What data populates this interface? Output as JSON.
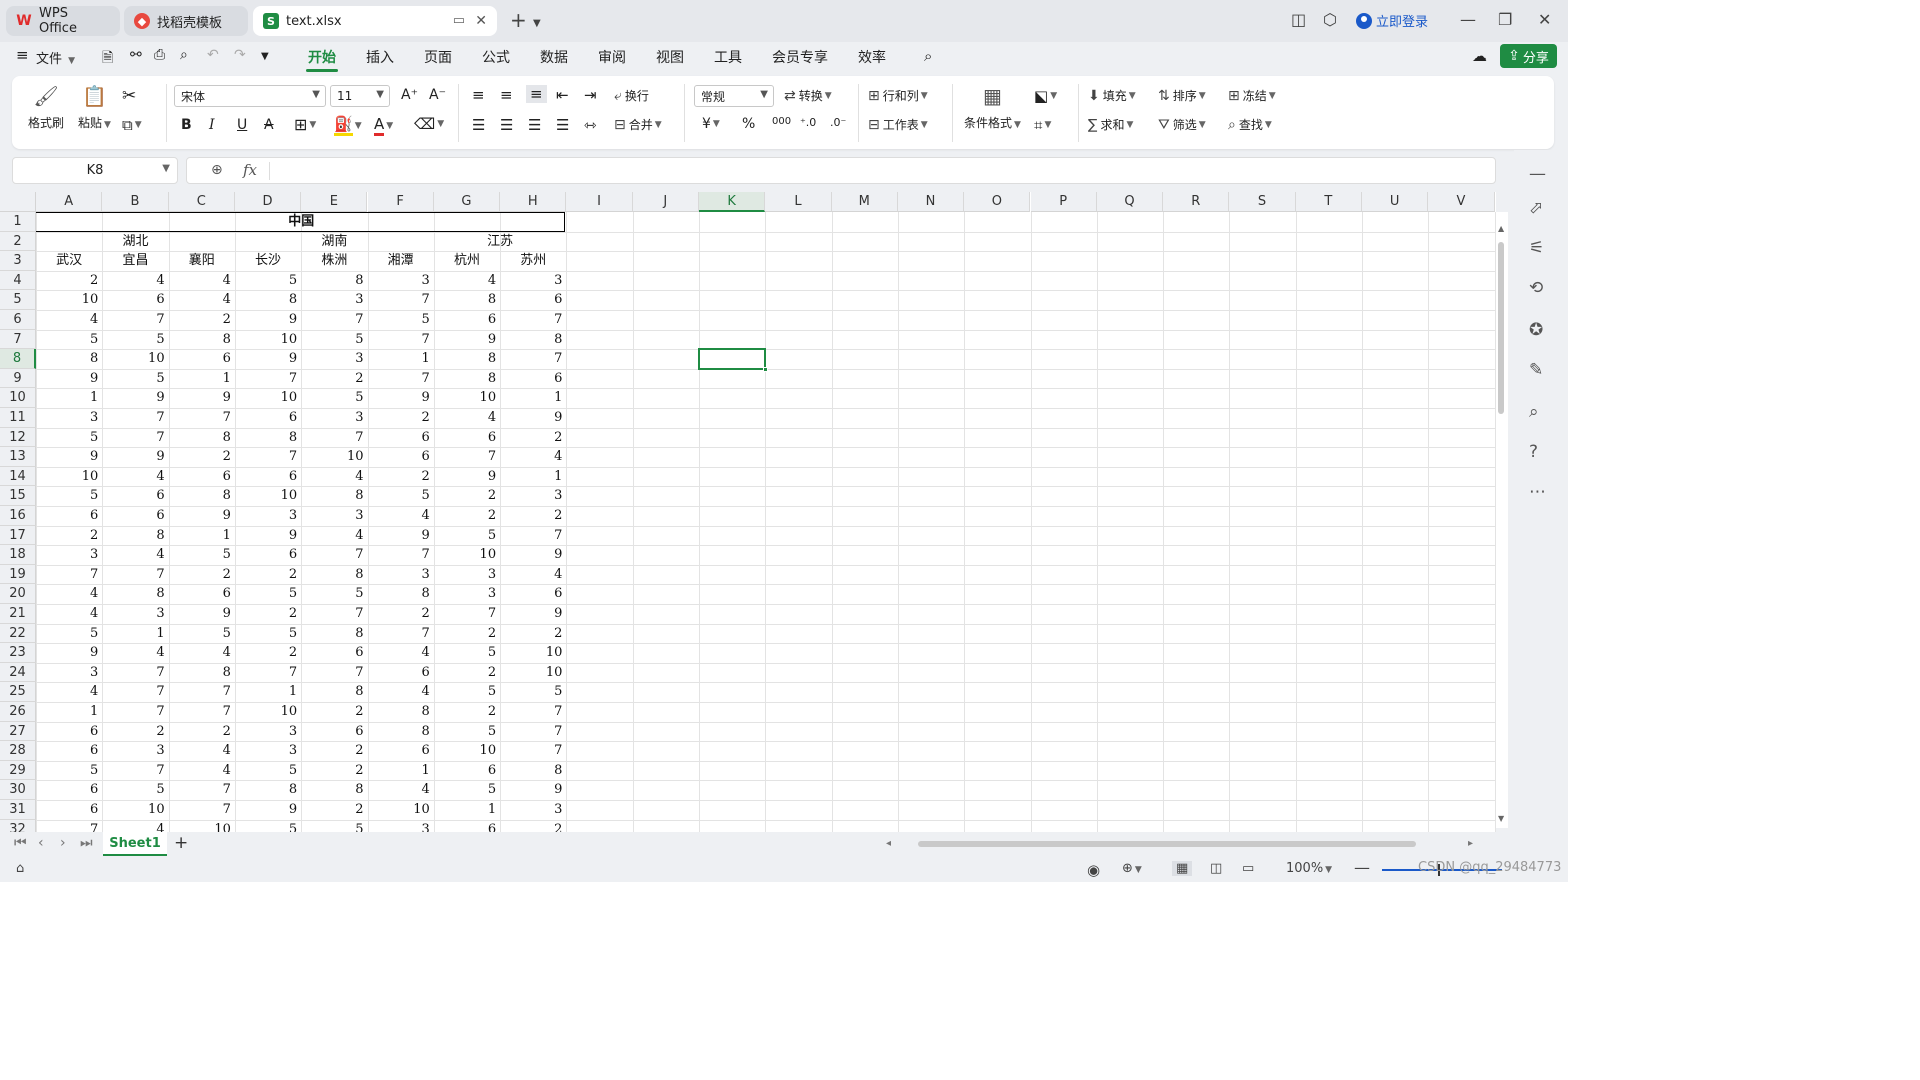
{
  "tabs": [
    {
      "label": "WPS Office",
      "icon": "wps-logo-icon",
      "active": false
    },
    {
      "label": "找稻壳模板",
      "icon": "docer-logo-icon",
      "active": false
    },
    {
      "label": "text.xlsx",
      "icon": "spreadsheet-file-icon",
      "active": true
    }
  ],
  "login": "立即登录",
  "menu": {
    "file": "文件",
    "items": [
      "开始",
      "插入",
      "页面",
      "公式",
      "数据",
      "审阅",
      "视图",
      "工具",
      "会员专享",
      "效率"
    ],
    "active": "开始",
    "share": "分享"
  },
  "ribbon": {
    "format_painter": "格式刷",
    "paste": "粘贴",
    "font_name": "宋体",
    "font_size": "11",
    "bold": "B",
    "italic": "I",
    "underline": "U",
    "wrap": "换行",
    "merge": "合并",
    "number_format": "常规",
    "convert": "转换",
    "currency": "¥",
    "percent": "%",
    "thousands": "000",
    "row_col": "行和列",
    "worksheet": "工作表",
    "cond_format": "条件格式",
    "fill": "填充",
    "sort": "排序",
    "freeze": "冻结",
    "sum": "求和",
    "filter": "筛选",
    "find": "查找"
  },
  "formula": {
    "name_box": "K8",
    "fx": "fx",
    "value": ""
  },
  "columns": [
    "A",
    "B",
    "C",
    "D",
    "E",
    "F",
    "G",
    "H",
    "I",
    "J",
    "K",
    "L",
    "M",
    "N",
    "O",
    "P",
    "Q",
    "R",
    "S",
    "T",
    "U",
    "V"
  ],
  "selected_col": "K",
  "selected_row": 8,
  "sheet": {
    "title": "中国",
    "provinces": [
      "湖北",
      "湖南",
      "江苏"
    ],
    "cities": [
      "武汉",
      "宜昌",
      "襄阳",
      "长沙",
      "株洲",
      "湘潭",
      "杭州",
      "苏州"
    ],
    "rows": [
      [
        2,
        4,
        4,
        5,
        8,
        3,
        4,
        3
      ],
      [
        10,
        6,
        4,
        8,
        3,
        7,
        8,
        6
      ],
      [
        4,
        7,
        2,
        9,
        7,
        5,
        6,
        7
      ],
      [
        5,
        5,
        8,
        10,
        5,
        7,
        9,
        8
      ],
      [
        8,
        10,
        6,
        9,
        3,
        1,
        8,
        7
      ],
      [
        9,
        5,
        1,
        7,
        2,
        7,
        8,
        6
      ],
      [
        1,
        9,
        9,
        10,
        5,
        9,
        10,
        1
      ],
      [
        3,
        7,
        7,
        6,
        3,
        2,
        4,
        9
      ],
      [
        5,
        7,
        8,
        8,
        7,
        6,
        6,
        2
      ],
      [
        9,
        9,
        2,
        7,
        10,
        6,
        7,
        4
      ],
      [
        10,
        4,
        6,
        6,
        4,
        2,
        9,
        1
      ],
      [
        5,
        6,
        8,
        10,
        8,
        5,
        2,
        3
      ],
      [
        6,
        6,
        9,
        3,
        3,
        4,
        2,
        2
      ],
      [
        2,
        8,
        1,
        9,
        4,
        9,
        5,
        7
      ],
      [
        3,
        4,
        5,
        6,
        7,
        7,
        10,
        9
      ],
      [
        7,
        7,
        2,
        2,
        8,
        3,
        3,
        4
      ],
      [
        4,
        8,
        6,
        5,
        5,
        8,
        3,
        6
      ],
      [
        4,
        3,
        9,
        2,
        7,
        2,
        7,
        9
      ],
      [
        5,
        1,
        5,
        5,
        8,
        7,
        2,
        2
      ],
      [
        9,
        4,
        4,
        2,
        6,
        4,
        5,
        10
      ],
      [
        3,
        7,
        8,
        7,
        7,
        6,
        2,
        10
      ],
      [
        4,
        7,
        7,
        1,
        8,
        4,
        5,
        5
      ],
      [
        1,
        7,
        7,
        10,
        2,
        8,
        2,
        7
      ],
      [
        6,
        2,
        2,
        3,
        6,
        8,
        5,
        7
      ],
      [
        6,
        3,
        4,
        3,
        2,
        6,
        10,
        7
      ],
      [
        5,
        7,
        4,
        5,
        2,
        1,
        6,
        8
      ],
      [
        6,
        5,
        7,
        8,
        8,
        4,
        5,
        9
      ],
      [
        6,
        10,
        7,
        9,
        2,
        10,
        1,
        3
      ],
      [
        7,
        4,
        10,
        5,
        5,
        3,
        6,
        2
      ]
    ]
  },
  "sheet_tab": "Sheet1",
  "status": {
    "zoom": "100%",
    "watermark": "CSDN @qq_29484773"
  }
}
